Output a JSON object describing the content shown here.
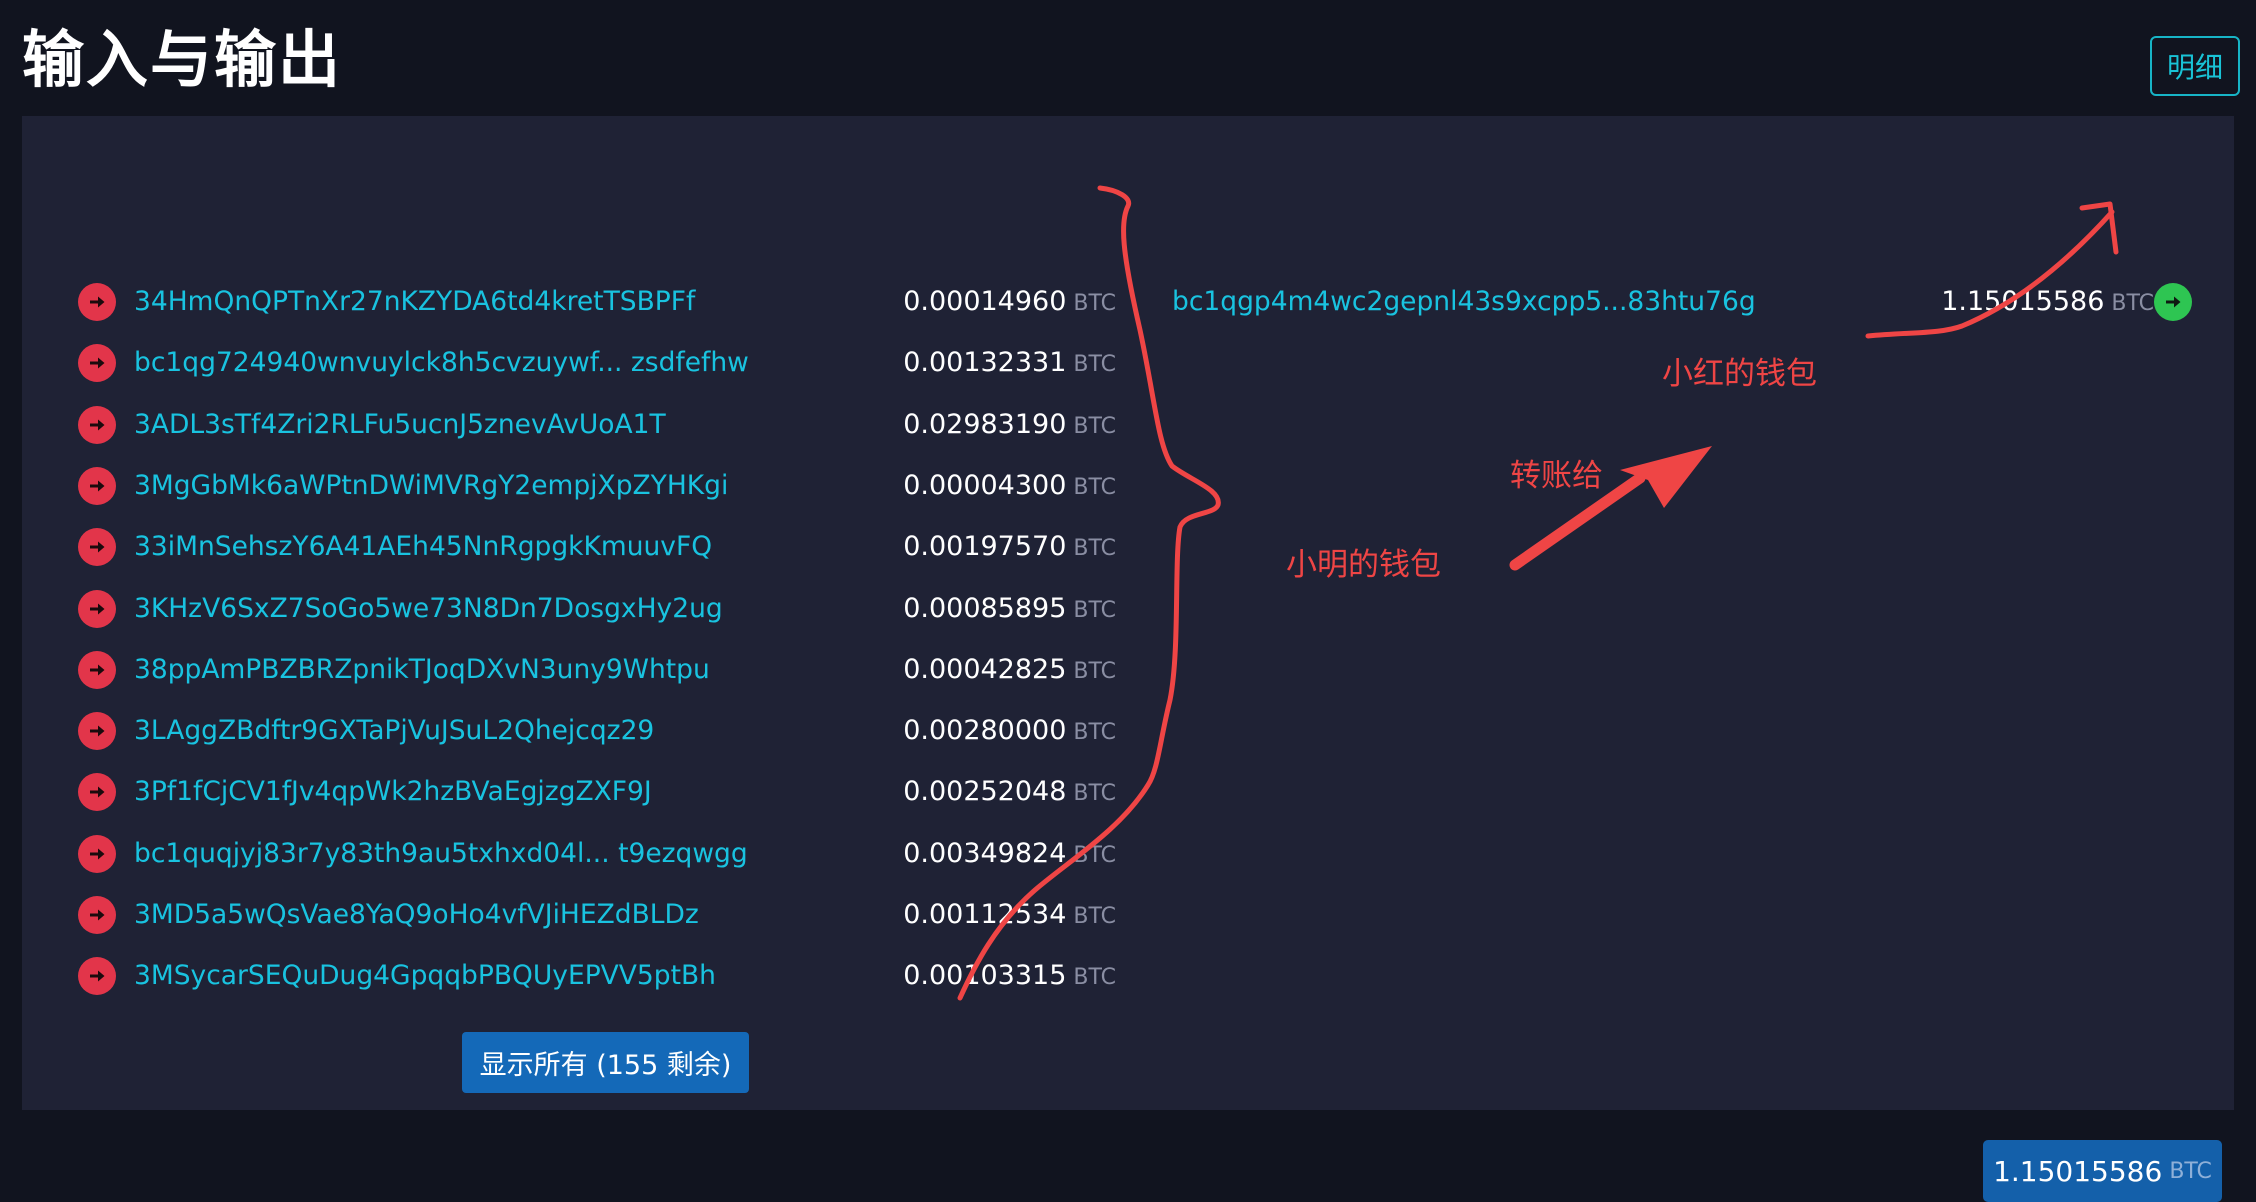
{
  "header": {
    "title": "输入与输出",
    "detail_button": "明细"
  },
  "inputs": [
    {
      "address": "34HmQnQPTnXr27nKZYDA6td4kretTSBPFf",
      "amount": "0.00014960",
      "unit": "BTC"
    },
    {
      "address": "bc1qg724940wnvuylck8h5cvzuywf... zsdfefhw",
      "amount": "0.00132331",
      "unit": "BTC"
    },
    {
      "address": "3ADL3sTf4Zri2RLFu5ucnJ5znevAvUoA1T",
      "amount": "0.02983190",
      "unit": "BTC"
    },
    {
      "address": "3MgGbMk6aWPtnDWiMVRgY2empjXpZYHKgi",
      "amount": "0.00004300",
      "unit": "BTC"
    },
    {
      "address": "33iMnSehszY6A41AEh45NnRgpgkKmuuvFQ",
      "amount": "0.00197570",
      "unit": "BTC"
    },
    {
      "address": "3KHzV6SxZ7SoGo5we73N8Dn7DosgxHy2ug",
      "amount": "0.00085895",
      "unit": "BTC"
    },
    {
      "address": "38ppAmPBZBRZpnikTJoqDXvN3uny9Whtpu",
      "amount": "0.00042825",
      "unit": "BTC"
    },
    {
      "address": "3LAggZBdftr9GXTaPjVuJSuL2Qhejcqz29",
      "amount": "0.00280000",
      "unit": "BTC"
    },
    {
      "address": "3Pf1fCjCV1fJv4qpWk2hzBVaEgjzgZXF9J",
      "amount": "0.00252048",
      "unit": "BTC"
    },
    {
      "address": "bc1quqjyj83r7y83th9au5txhxd04l...  t9ezqwgg",
      "amount": "0.00349824",
      "unit": "BTC"
    },
    {
      "address": "3MD5a5wQsVae8YaQ9oHo4vfVJiHEZdBLDz",
      "amount": "0.00112534",
      "unit": "BTC"
    },
    {
      "address": "3MSycarSEQuDug4GpqqbPBQUyEPVV5ptBh",
      "amount": "0.00103315",
      "unit": "BTC"
    }
  ],
  "output": {
    "address": "bc1qgp4m4wc2gepnl43s9xcpp5...83htu76g",
    "amount": "1.15015586",
    "unit": "BTC"
  },
  "show_all_button": "显示所有 (155 剩余)",
  "total": {
    "amount": "1.15015586",
    "unit": "BTC"
  },
  "annotations": {
    "sender_wallet": "小明的钱包",
    "transfer_to": "转账给",
    "receiver_wallet": "小红的钱包"
  },
  "colors": {
    "input_icon": "#e2354a",
    "output_icon": "#2ec552",
    "link": "#19c3e0",
    "annotation": "#ef4545",
    "button": "#1469b8"
  },
  "icons": {
    "input_row": "arrow-right-circle-icon",
    "output_row": "arrow-right-circle-icon"
  }
}
